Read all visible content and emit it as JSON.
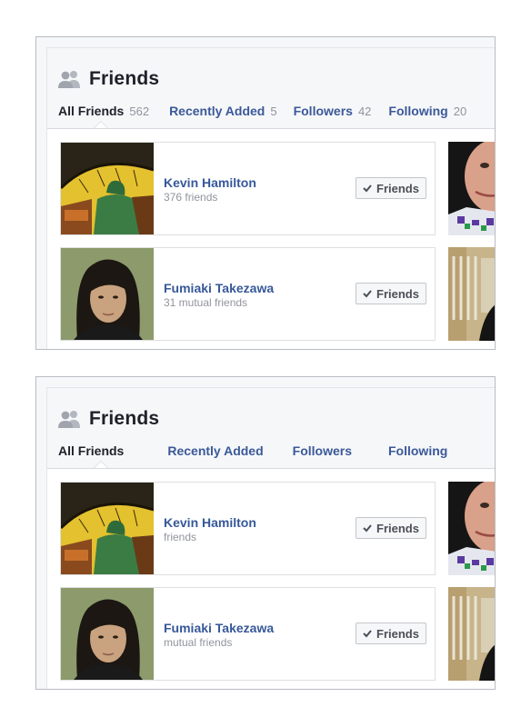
{
  "panels": [
    {
      "title": "Friends",
      "tabs": [
        {
          "label": "All Friends",
          "count": "562"
        },
        {
          "label": "Recently Added",
          "count": "5"
        },
        {
          "label": "Followers",
          "count": "42"
        },
        {
          "label": "Following",
          "count": "20"
        }
      ],
      "friends": [
        {
          "name": "Kevin Hamilton",
          "sub": "376 friends",
          "button": "Friends"
        },
        {
          "name": "Fumiaki Takezawa",
          "sub": "31 mutual friends",
          "button": "Friends"
        }
      ]
    },
    {
      "title": "Friends",
      "tabs": [
        {
          "label": "All Friends",
          "count": ""
        },
        {
          "label": "Recently Added",
          "count": ""
        },
        {
          "label": "Followers",
          "count": ""
        },
        {
          "label": "Following",
          "count": ""
        }
      ],
      "friends": [
        {
          "name": "Kevin Hamilton",
          "sub": "friends",
          "button": "Friends"
        },
        {
          "name": "Fumiaki Takezawa",
          "sub": "mutual friends",
          "button": "Friends"
        }
      ]
    }
  ],
  "icons": {
    "header": "friends-icon",
    "button": "check-icon"
  },
  "colors": {
    "link": "#365899",
    "tab": "#3b5998",
    "muted": "#90949c",
    "title": "#1d2129"
  }
}
